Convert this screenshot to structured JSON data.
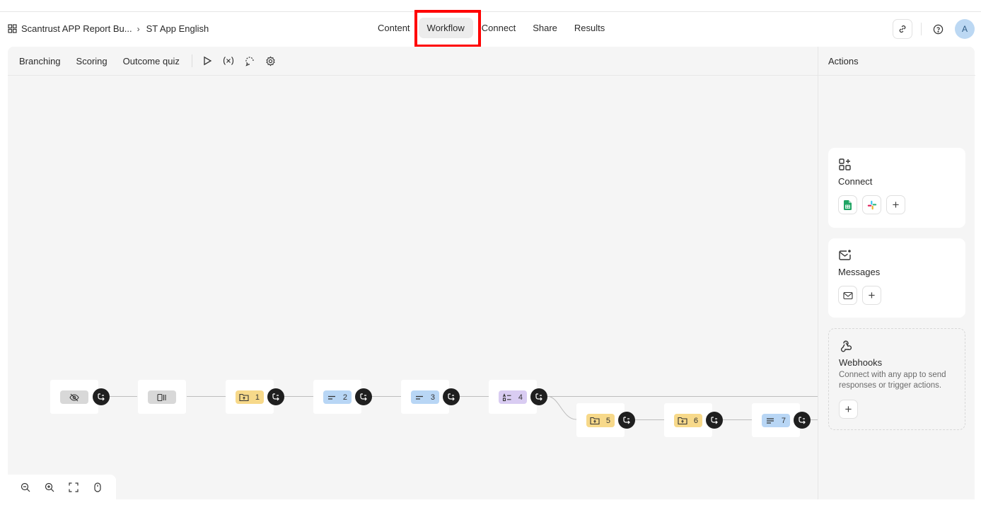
{
  "header": {
    "breadcrumb": {
      "project": "Scantrust APP Report Bu...",
      "page": "ST App English"
    },
    "tabs": [
      {
        "label": "Content",
        "active": false
      },
      {
        "label": "Workflow",
        "active": true
      },
      {
        "label": "Connect",
        "active": false
      },
      {
        "label": "Share",
        "active": false
      },
      {
        "label": "Results",
        "active": false
      }
    ],
    "avatar_initial": "A"
  },
  "toolbar": {
    "items": [
      "Branching",
      "Scoring",
      "Outcome quiz"
    ],
    "icons": [
      "play-icon",
      "variables-icon",
      "logic-loop-icon",
      "settings-icon"
    ]
  },
  "workflow": {
    "nodes": [
      {
        "kind": "hidden",
        "color": "grey",
        "icon": "eye-off-icon",
        "number": ""
      },
      {
        "kind": "welcome",
        "color": "grey",
        "icon": "welcome-screen-icon",
        "number": ""
      },
      {
        "kind": "question-group",
        "color": "yellow",
        "icon": "group-icon",
        "number": "1"
      },
      {
        "kind": "short-text",
        "color": "blue",
        "icon": "short-text-icon",
        "number": "2"
      },
      {
        "kind": "short-text",
        "color": "blue",
        "icon": "short-text-icon",
        "number": "3"
      },
      {
        "kind": "multiple-choice",
        "color": "purple",
        "icon": "multiple-choice-icon",
        "number": "4"
      },
      {
        "kind": "question-group",
        "color": "yellow",
        "icon": "group-icon",
        "number": "5"
      },
      {
        "kind": "question-group",
        "color": "yellow",
        "icon": "group-icon",
        "number": "6"
      },
      {
        "kind": "long-text",
        "color": "blue",
        "icon": "long-text-icon",
        "number": "7"
      }
    ]
  },
  "zoom_controls": [
    "zoom-out-icon",
    "zoom-in-icon",
    "fit-screen-icon",
    "mouse-icon"
  ],
  "actions": {
    "title": "Actions",
    "connect": {
      "title": "Connect",
      "integrations": [
        "google-sheets-icon",
        "slack-icon"
      ]
    },
    "messages": {
      "title": "Messages"
    },
    "webhooks": {
      "title": "Webhooks",
      "description": "Connect with any app to send responses or trigger actions."
    }
  }
}
